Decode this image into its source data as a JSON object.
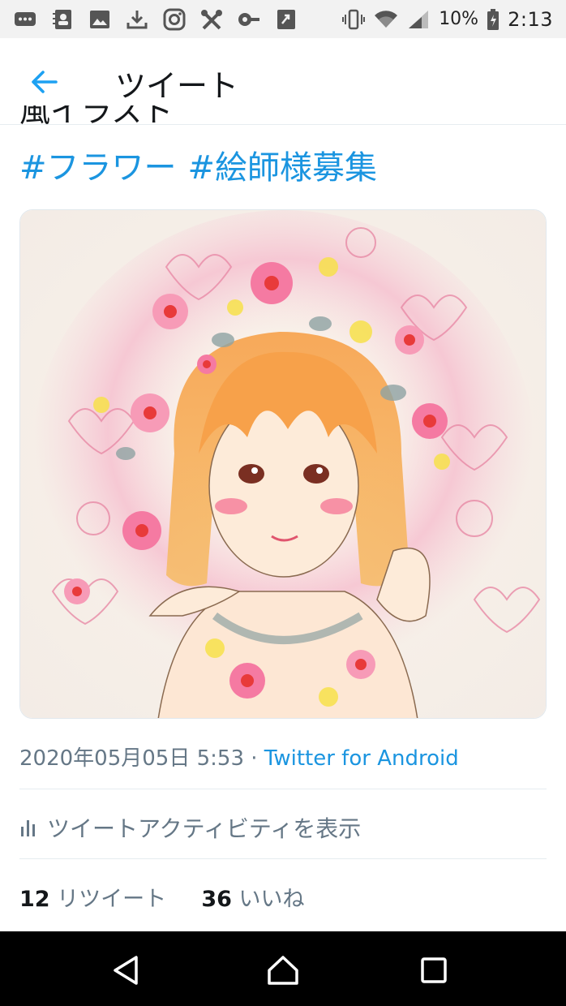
{
  "status_bar": {
    "battery_percent": "10%",
    "time": "2:13",
    "icons_left": [
      "message-icon",
      "contacts-icon",
      "image-icon",
      "download-icon",
      "instagram-icon",
      "tools-icon",
      "key-icon",
      "app-icon"
    ],
    "icons_right": [
      "vibrate-icon",
      "wifi-icon",
      "signal-icon",
      "battery-icon"
    ]
  },
  "header": {
    "title": "ツイート",
    "back_icon": "arrow-left-icon",
    "accent": "#1da1f2"
  },
  "tweet": {
    "clipped_text": "風イラスト",
    "hashtags": [
      "#フラワー",
      "#絵師様募集"
    ],
    "date": "2020年05月05日 5:53 · ",
    "source": "Twitter for Android",
    "activity_label": "ツイートアクティビティを表示",
    "retweet_count": "12",
    "retweet_label": "リツイート",
    "like_count": "36",
    "like_label": "いいね"
  },
  "colors": {
    "link": "#1b95e0",
    "muted": "#657786",
    "text": "#14171a"
  }
}
